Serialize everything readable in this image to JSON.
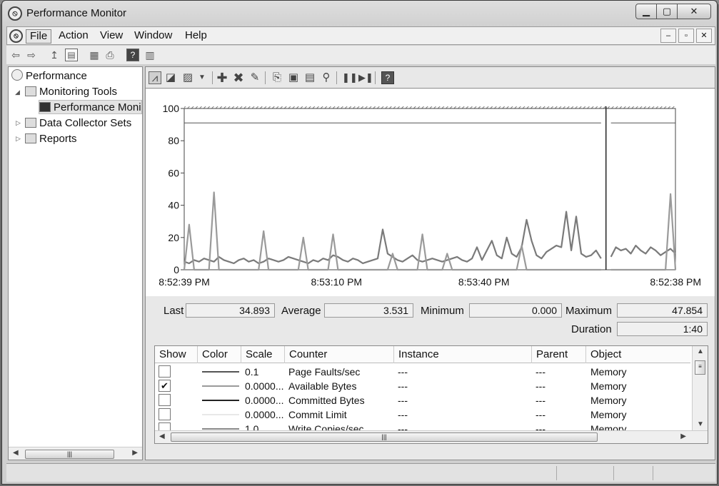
{
  "window": {
    "title": "Performance Monitor",
    "controls": {
      "minimize": "▁",
      "maximize": "▢",
      "close": "✕"
    }
  },
  "menubar": {
    "items": [
      "File",
      "Action",
      "View",
      "Window",
      "Help"
    ],
    "active": "File",
    "mdi_controls": {
      "minimize": "–",
      "restore": "▫",
      "close": "✕"
    }
  },
  "toolbar1": {
    "icons": [
      "back-icon",
      "forward-icon",
      "up-icon",
      "show-hide-tree-icon",
      "properties-icon",
      "print-icon",
      "help-icon",
      "show-action-pane-icon"
    ]
  },
  "tree": {
    "items": [
      {
        "label": "Performance",
        "icon": "performance-icon",
        "level": 0
      },
      {
        "label": "Monitoring Tools",
        "icon": "folder-icon",
        "level": 1,
        "expanded": true
      },
      {
        "label": "Performance Moni",
        "icon": "monitor-icon",
        "level": 2,
        "selected": true
      },
      {
        "label": "Data Collector Sets",
        "icon": "folder-icon",
        "level": 1,
        "expanded": false
      },
      {
        "label": "Reports",
        "icon": "folder-icon",
        "level": 1,
        "expanded": false
      }
    ]
  },
  "toolbar2": {
    "icons": [
      "view-graph-icon",
      "view-current-activity-icon",
      "change-graph-type-icon",
      "dropdown-icon",
      "add-counter-icon",
      "delete-counter-icon",
      "highlight-icon",
      "copy-properties-icon",
      "paste-counter-list-icon",
      "properties-icon",
      "zoom-icon",
      "freeze-display-icon",
      "update-data-icon",
      "help-icon"
    ]
  },
  "chart_data": {
    "type": "line",
    "y_ticks": [
      "100",
      "80",
      "60",
      "40",
      "20",
      "0"
    ],
    "ylim": [
      0,
      100
    ],
    "x_tick_labels": [
      "8:52:39 PM",
      "8:53:10 PM",
      "8:53:40 PM",
      "8:52:38 PM"
    ],
    "grid": false,
    "series": [
      {
        "name": "Available Bytes",
        "color": "#555555",
        "values": [
          91,
          91,
          91,
          91,
          91,
          91,
          91,
          91,
          91,
          91,
          91,
          91,
          91,
          91,
          91,
          91,
          91,
          91,
          91,
          91,
          91,
          91,
          91,
          91,
          91,
          91,
          91,
          91,
          91,
          91,
          91,
          91,
          91,
          91,
          91,
          91,
          91,
          91,
          91,
          91,
          91,
          91,
          91,
          91,
          91,
          91,
          91,
          91,
          91,
          91,
          91,
          91,
          91,
          91,
          91,
          91,
          91,
          91,
          91,
          91,
          91,
          91,
          91,
          91,
          91,
          91,
          91,
          91,
          91,
          91,
          91,
          91,
          91,
          91,
          91,
          91,
          91,
          91,
          91,
          91,
          91,
          91,
          91,
          91,
          91,
          91,
          91,
          91,
          91,
          91,
          91,
          91,
          91,
          91,
          91,
          91,
          91,
          91,
          91,
          91
        ]
      },
      {
        "name": "Page Faults/sec",
        "color": "#7a7a7a",
        "values": [
          5,
          4,
          6,
          5,
          7,
          6,
          5,
          8,
          6,
          5,
          4,
          6,
          7,
          5,
          6,
          4,
          5,
          7,
          6,
          5,
          6,
          8,
          7,
          6,
          5,
          4,
          6,
          5,
          7,
          6,
          9,
          8,
          6,
          5,
          7,
          6,
          4,
          5,
          6,
          7,
          25,
          10,
          8,
          6,
          5,
          7,
          9,
          6,
          5,
          6,
          7,
          6,
          5,
          6,
          7,
          8,
          6,
          5,
          7,
          14,
          6,
          12,
          18,
          9,
          7,
          20,
          10,
          8,
          14,
          31,
          18,
          9,
          7,
          11,
          13,
          15,
          14,
          36,
          12,
          33,
          10,
          8,
          9,
          12,
          7,
          6,
          8,
          14,
          12,
          13,
          10,
          15,
          12,
          10,
          14,
          12,
          9,
          11,
          13,
          10
        ]
      },
      {
        "name": "Committed Bytes",
        "color": "#9a9a9a",
        "values": [
          0,
          28,
          0,
          0,
          0,
          0,
          48,
          0,
          0,
          0,
          0,
          0,
          0,
          0,
          0,
          0,
          24,
          0,
          0,
          0,
          0,
          0,
          0,
          0,
          20,
          0,
          0,
          0,
          0,
          0,
          22,
          0,
          0,
          0,
          0,
          0,
          0,
          0,
          0,
          0,
          0,
          0,
          10,
          0,
          0,
          0,
          0,
          0,
          22,
          0,
          0,
          0,
          0,
          10,
          0,
          0,
          0,
          0,
          0,
          0,
          0,
          0,
          0,
          0,
          0,
          0,
          0,
          0,
          15,
          0,
          0,
          0,
          0,
          0,
          0,
          0,
          0,
          0,
          0,
          0,
          0,
          0,
          0,
          0,
          0,
          0,
          0,
          0,
          0,
          0,
          0,
          0,
          0,
          0,
          0,
          0,
          0,
          0,
          47,
          0
        ]
      }
    ],
    "cursor_index": 85
  },
  "stats": {
    "last_label": "Last",
    "last": "34.893",
    "average_label": "Average",
    "average": "3.531",
    "minimum_label": "Minimum",
    "minimum": "0.000",
    "maximum_label": "Maximum",
    "maximum": "47.854",
    "duration_label": "Duration",
    "duration": "1:40"
  },
  "counters": {
    "columns": [
      "Show",
      "Color",
      "Scale",
      "Counter",
      "Instance",
      "Parent",
      "Object"
    ],
    "rows": [
      {
        "show": false,
        "color": "#555555",
        "scale": "0.1",
        "counter": "Page Faults/sec",
        "instance": "---",
        "parent": "---",
        "object": "Memory"
      },
      {
        "show": true,
        "color": "#9a9a9a",
        "scale": "0.0000...",
        "counter": "Available Bytes",
        "instance": "---",
        "parent": "---",
        "object": "Memory"
      },
      {
        "show": false,
        "color": "#222222",
        "scale": "0.0000...",
        "counter": "Committed Bytes",
        "instance": "---",
        "parent": "---",
        "object": "Memory"
      },
      {
        "show": false,
        "color": "#e8e8e8",
        "scale": "0.0000...",
        "counter": "Commit Limit",
        "instance": "---",
        "parent": "---",
        "object": "Memory"
      },
      {
        "show": false,
        "color": "#888888",
        "scale": "1.0",
        "counter": "Write Copies/sec",
        "instance": "---",
        "parent": "---",
        "object": "Memory"
      }
    ],
    "check_mark": "✔"
  }
}
